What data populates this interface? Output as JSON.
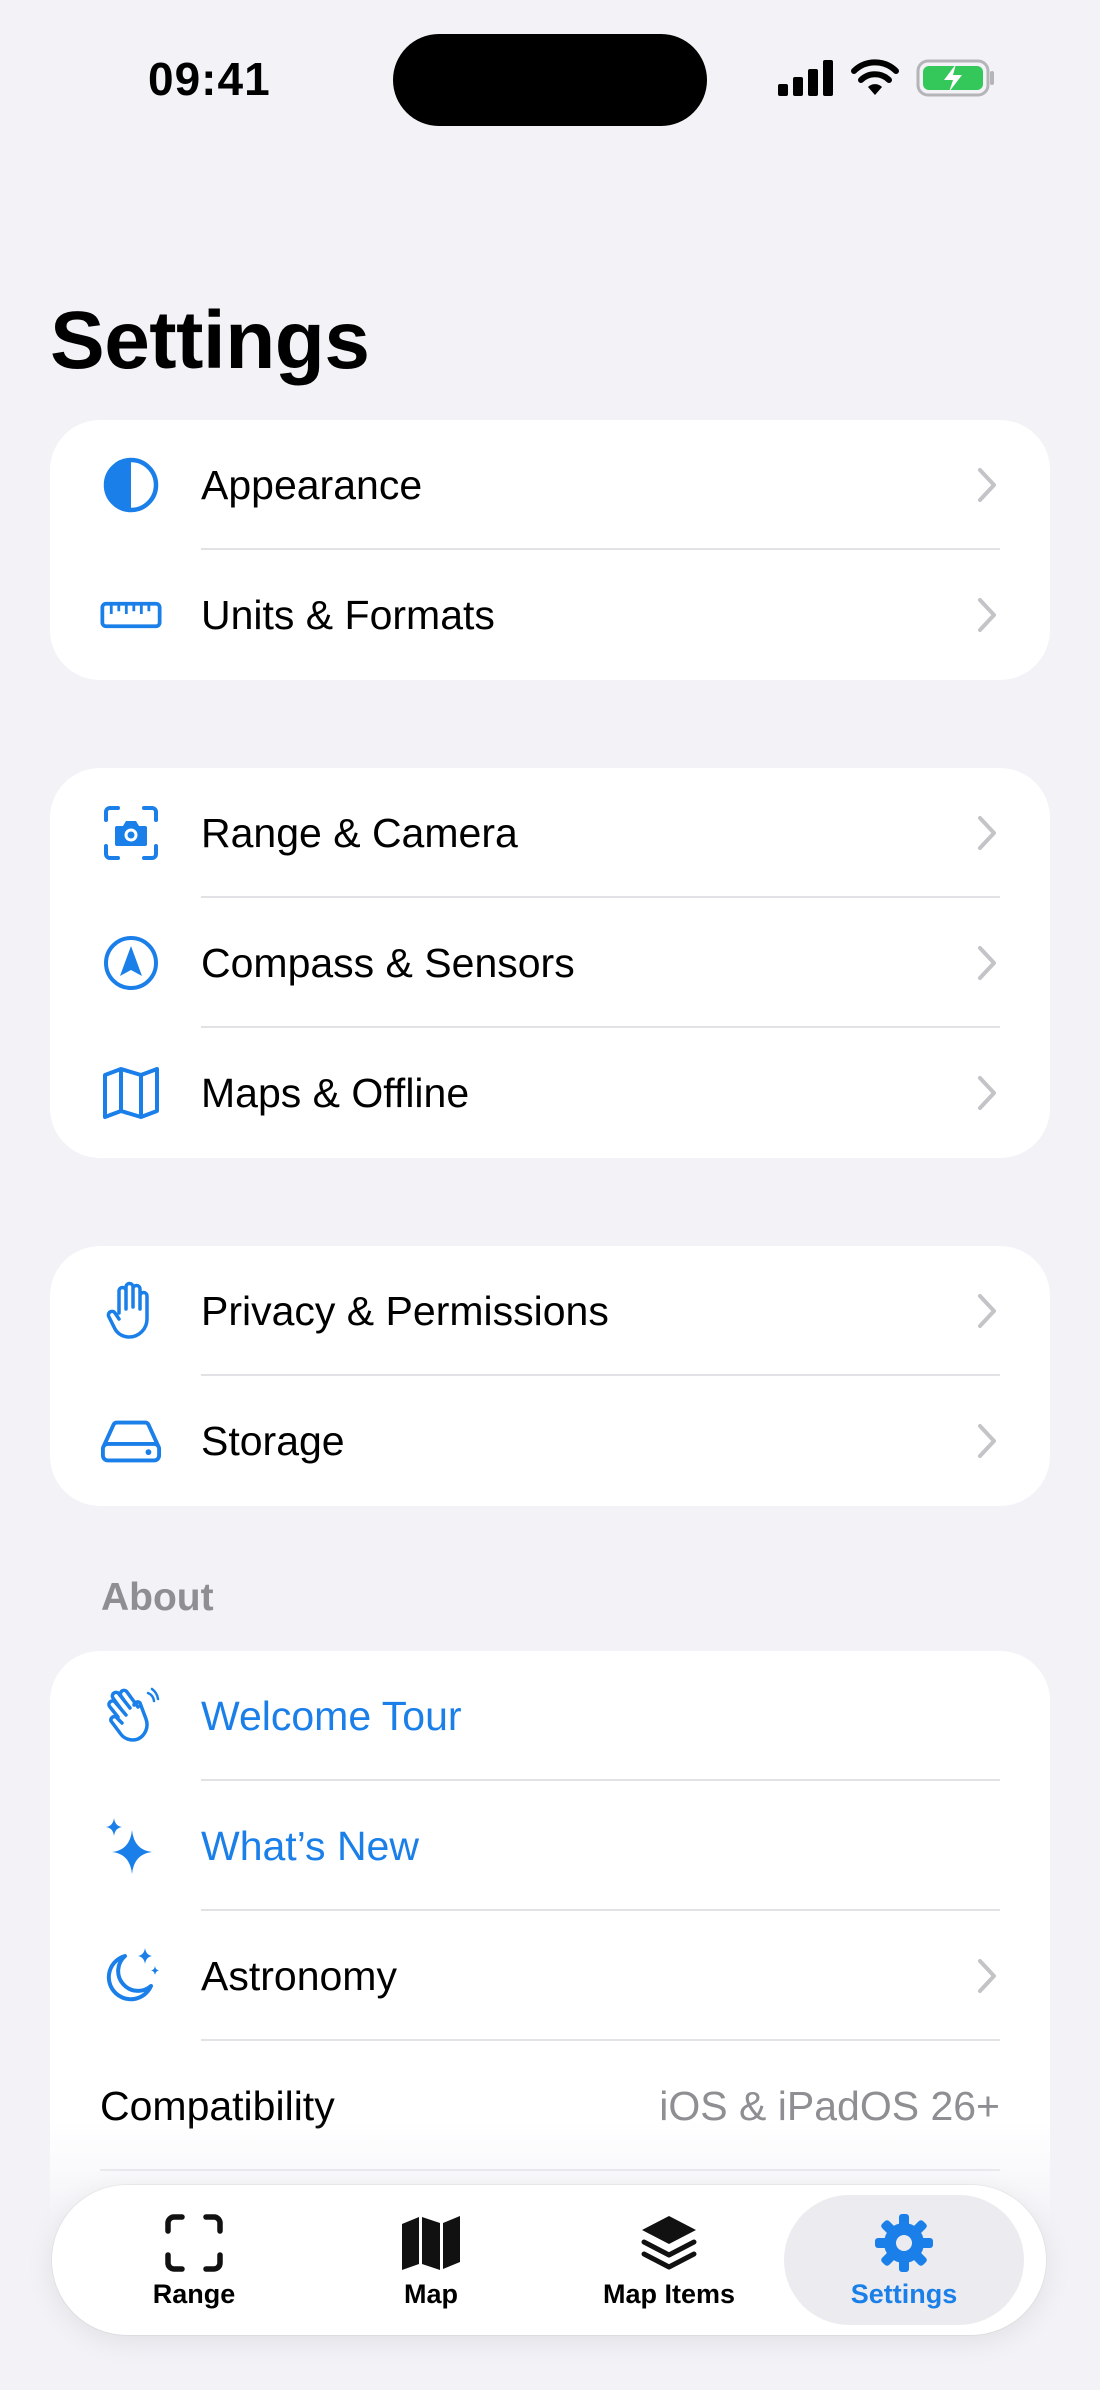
{
  "status_bar": {
    "time": "09:41"
  },
  "page_title": "Settings",
  "groups": {
    "general": {
      "appearance": {
        "label": "Appearance"
      },
      "units": {
        "label": "Units & Formats"
      }
    },
    "features": {
      "range_camera": {
        "label": "Range & Camera"
      },
      "compass": {
        "label": "Compass & Sensors"
      },
      "maps": {
        "label": "Maps & Offline"
      }
    },
    "data": {
      "privacy": {
        "label": "Privacy & Permissions"
      },
      "storage": {
        "label": "Storage"
      }
    },
    "about": {
      "header": "About",
      "welcome": {
        "label": "Welcome Tour"
      },
      "whats_new": {
        "label": "What’s New"
      },
      "astronomy": {
        "label": "Astronomy"
      },
      "compatibility": {
        "label": "Compatibility",
        "value": "iOS & iPadOS 26+"
      }
    }
  },
  "tab_bar": {
    "tabs": [
      {
        "label": "Range",
        "icon": "viewfinder-icon"
      },
      {
        "label": "Map",
        "icon": "map-icon"
      },
      {
        "label": "Map Items",
        "icon": "layers-icon"
      },
      {
        "label": "Settings",
        "icon": "gear-icon",
        "selected": true
      }
    ]
  },
  "colors": {
    "accent": "#1a7fe8",
    "background": "#f2f2f7",
    "secondary_text": "#8e8e93",
    "battery": "#34c759"
  }
}
